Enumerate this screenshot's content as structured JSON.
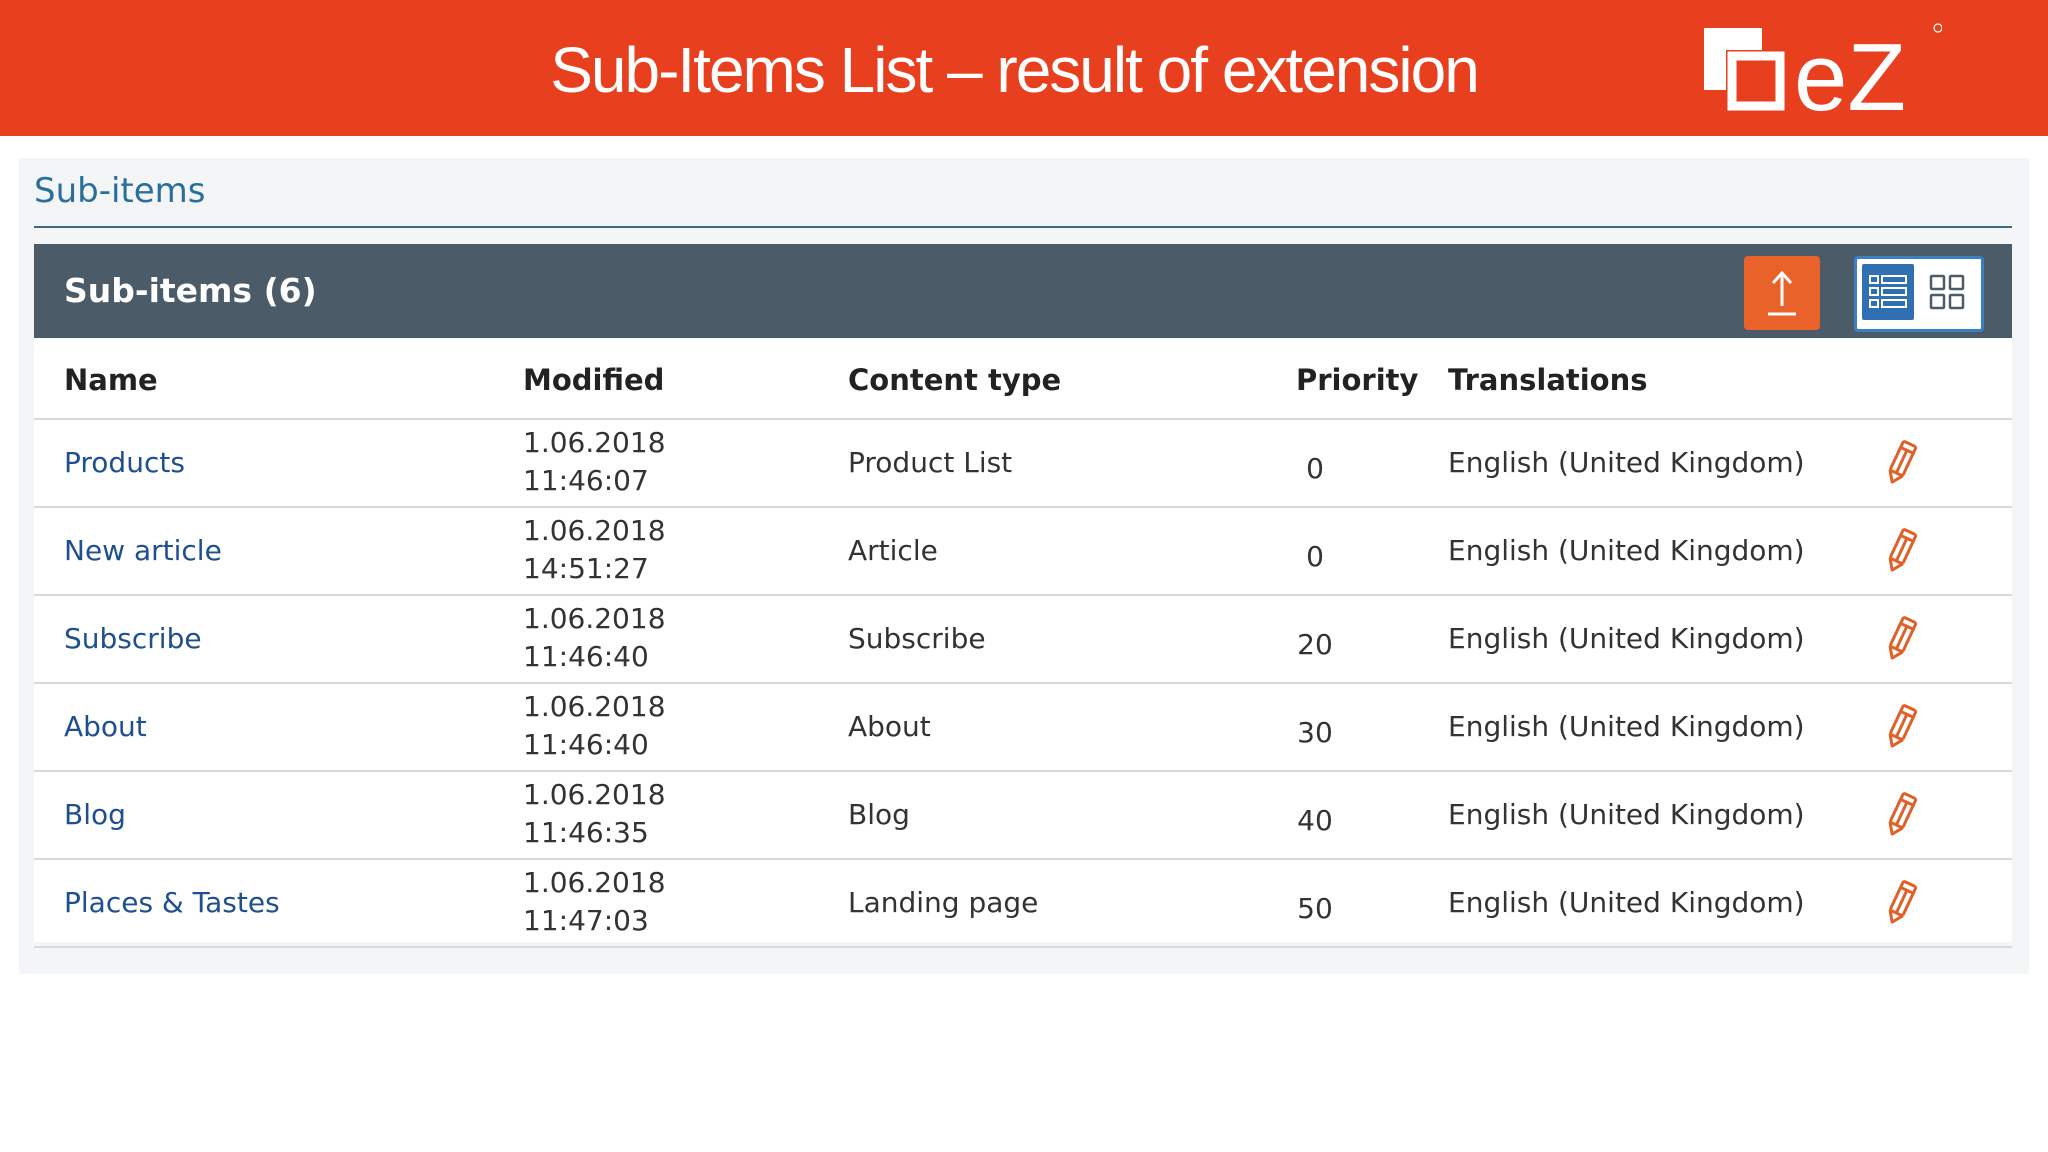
{
  "slide": {
    "title": "Sub-Items List – result of extension",
    "logo_text": "eZ"
  },
  "section": {
    "title": "Sub-items"
  },
  "table": {
    "title": "Sub-items (6)",
    "columns": {
      "name": "Name",
      "modified": "Modified",
      "content_type": "Content type",
      "priority": "Priority",
      "translations": "Translations"
    },
    "rows": [
      {
        "name": "Products",
        "modified_date": "1.06.2018",
        "modified_time": "11:46:07",
        "content_type": "Product List",
        "priority": "0",
        "translations": "English (United Kingdom)"
      },
      {
        "name": "New article",
        "modified_date": "1.06.2018",
        "modified_time": "14:51:27",
        "content_type": "Article",
        "priority": "0",
        "translations": "English (United Kingdom)"
      },
      {
        "name": "Subscribe",
        "modified_date": "1.06.2018",
        "modified_time": "11:46:40",
        "content_type": "Subscribe",
        "priority": "20",
        "translations": "English (United Kingdom)"
      },
      {
        "name": "About",
        "modified_date": "1.06.2018",
        "modified_time": "11:46:40",
        "content_type": "About",
        "priority": "30",
        "translations": "English (United Kingdom)"
      },
      {
        "name": "Blog",
        "modified_date": "1.06.2018",
        "modified_time": "11:46:35",
        "content_type": "Blog",
        "priority": "40",
        "translations": "English (United Kingdom)"
      },
      {
        "name": "Places & Tastes",
        "modified_date": "1.06.2018",
        "modified_time": "11:47:03",
        "content_type": "Landing page",
        "priority": "50",
        "translations": "English (United Kingdom)"
      }
    ]
  },
  "icons": {
    "upload": "upload-icon",
    "list_view": "list-view-icon",
    "grid_view": "grid-view-icon",
    "edit": "pencil-icon"
  },
  "colors": {
    "brand_red": "#e8401e",
    "header_slate": "#4b5b67",
    "link_blue": "#1f4f8f",
    "accent_orange": "#e8622a",
    "toggle_blue": "#2f6fb2"
  }
}
